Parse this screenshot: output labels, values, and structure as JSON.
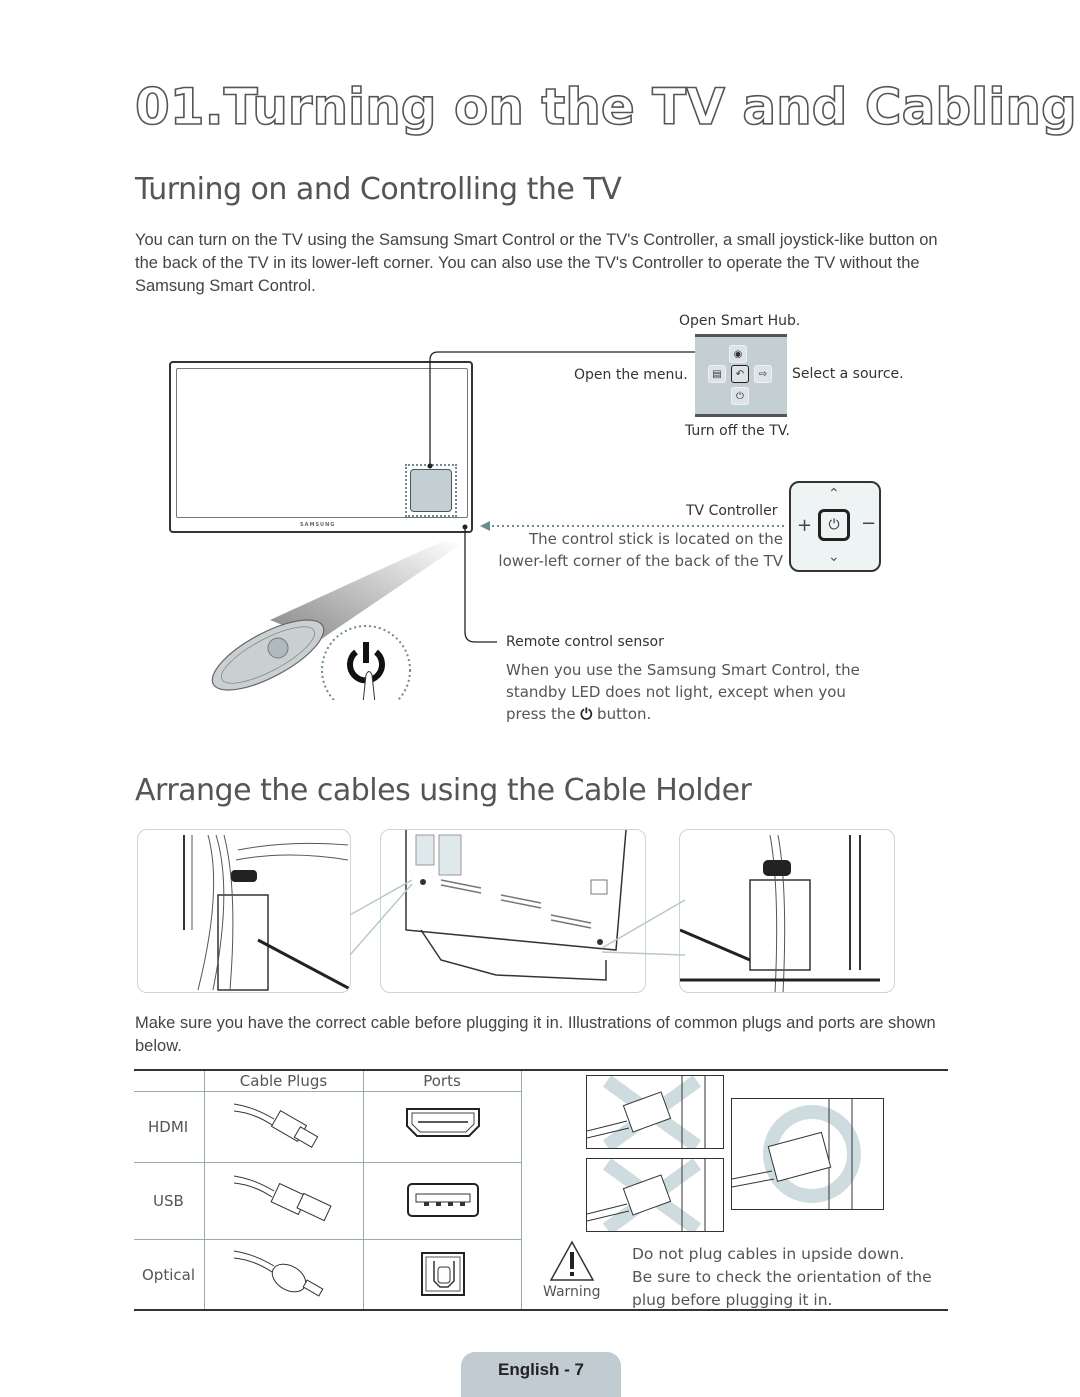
{
  "page": {
    "title": "01.Turning on the TV and Cabling",
    "footer": "English - 7"
  },
  "section1": {
    "heading": "Turning on and Controlling the TV",
    "intro_lines": [
      "You can turn on the TV using the Samsung Smart Control or the TV's Controller, a small joystick-like button on",
      "the back of the TV in its lower-left corner. You can also use the TV's Controller to operate the TV without the",
      "Samsung Smart Control."
    ],
    "tv_brand": "SAMSUNG",
    "controller_callouts": {
      "up": "Open Smart Hub.",
      "left": "Open the menu.",
      "right": "Select a source.",
      "down": "Turn off the TV."
    },
    "controller_icons": {
      "up": "smart-hub-icon",
      "left": "menu-icon",
      "center": "return-icon",
      "right": "source-icon",
      "down": "power-icon"
    },
    "tv_controller": {
      "label": "TV Controller",
      "desc_lines": [
        "The control stick is located on the",
        "lower-left corner of the back of the TV"
      ],
      "icons": {
        "up": "chevron-up-icon",
        "down": "chevron-down-icon",
        "left": "plus-icon",
        "right": "minus-icon",
        "center": "power-icon"
      }
    },
    "remote_sensor": {
      "label": "Remote control sensor",
      "desc_lines": [
        "When you use the Samsung Smart Control, the",
        "standby LED does not light, except when you"
      ],
      "desc_last_before": "press the",
      "desc_last_after": "button."
    }
  },
  "section2": {
    "heading": "Arrange the cables using the Cable Holder",
    "intro_lines": [
      "Make sure you have the correct cable before plugging it in. Illustrations of common plugs and ports are shown",
      "below."
    ],
    "table": {
      "headers": [
        "",
        "Cable Plugs",
        "Ports"
      ],
      "rows": [
        {
          "name": "HDMI"
        },
        {
          "name": "USB"
        },
        {
          "name": "Optical"
        }
      ]
    },
    "warning": {
      "label": "Warning",
      "lines": [
        "Do not plug cables in upside down.",
        "Be sure to check the orientation of the",
        "plug before plugging it in."
      ]
    }
  }
}
